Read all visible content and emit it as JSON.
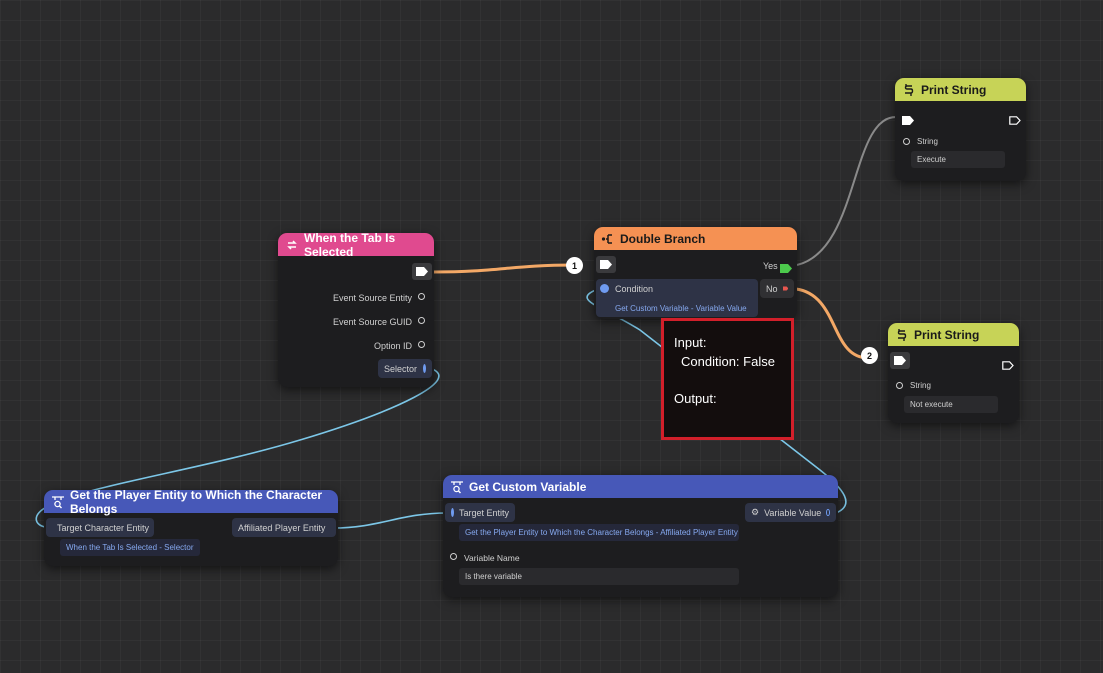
{
  "colors": {
    "event_header": "#e04a8f",
    "branch_header": "#f59153",
    "print_header": "#c7d357",
    "query_header": "#4758b8",
    "wire_exec": "#f3a866",
    "wire_data": "#7cc7e8",
    "tooltip_border": "#d21f2a"
  },
  "nodes": {
    "tab_selected": {
      "title": "When the Tab Is Selected",
      "icon": "event-loop-icon",
      "pins": [
        "Event Source Entity",
        "Event Source GUID",
        "Option ID",
        "Selector"
      ]
    },
    "double_branch": {
      "title": "Double Branch",
      "icon": "branch-icon",
      "condition_label": "Condition",
      "condition_value": "Get Custom Variable - Variable Value",
      "yes_label": "Yes",
      "no_label": "No"
    },
    "print_string_1": {
      "title": "Print String",
      "icon": "print-icon",
      "string_label": "String",
      "string_value": "Execute"
    },
    "print_string_2": {
      "title": "Print String",
      "icon": "print-icon",
      "string_label": "String",
      "string_value": "Not execute"
    },
    "get_player_entity": {
      "title": "Get the Player Entity to Which the Character Belongs",
      "icon": "query-icon",
      "input_label": "Target Character Entity",
      "input_value": "When the Tab Is Selected - Selector",
      "output_label": "Affiliated Player Entity"
    },
    "get_custom_variable": {
      "title": "Get Custom Variable",
      "icon": "query-icon",
      "target_label": "Target Entity",
      "target_value": "Get the Player Entity to Which the Character Belongs - Affiliated Player Entity",
      "output_label": "Variable Value",
      "name_label": "Variable Name",
      "name_value": "Is there variable"
    }
  },
  "badges": {
    "first": "1",
    "second": "2"
  },
  "tooltip": {
    "input_heading": "Input:",
    "condition_line": "Condition: False",
    "output_heading": "Output:"
  }
}
